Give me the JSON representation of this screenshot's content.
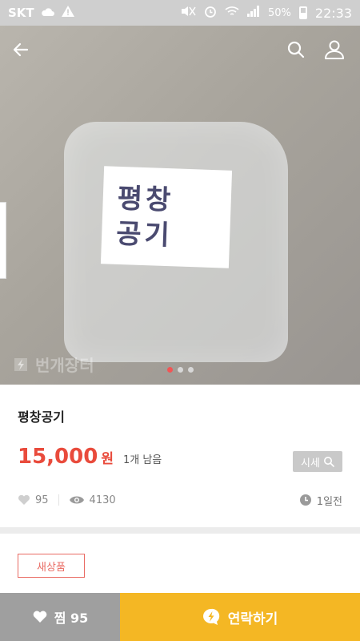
{
  "status_bar": {
    "carrier": "SKT",
    "battery": "50%",
    "time": "22:33"
  },
  "product": {
    "image_note": "평창\n공기",
    "watermark": "번개장터",
    "image_count": 3,
    "active_image_index": 0,
    "title": "평창공기",
    "price": "15,000",
    "currency": "원",
    "stock": "1개 남음",
    "market_price_label": "시세",
    "likes": "95",
    "views": "4130",
    "posted": "1일전",
    "condition_tag": "새상품"
  },
  "bottom_bar": {
    "like_label": "찜 95",
    "contact_label": "연락하기"
  },
  "colors": {
    "accent_red": "#e94b3c",
    "contact_yellow": "#f4b724",
    "like_gray": "#9f9f9f"
  }
}
